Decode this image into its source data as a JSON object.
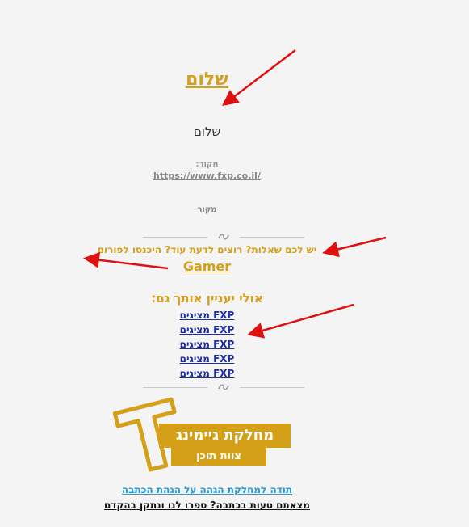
{
  "post": {
    "title": "שלום",
    "greeting": "שלום",
    "source_label": "מקור:",
    "source_url": "https://www.fxp.co.il/",
    "source_link": "מקור"
  },
  "forum": {
    "question": "יש לכם שאלות? רוצים לדעת עוד? היכנסו לפורום",
    "forum_link": "Gamer"
  },
  "related": {
    "heading": "אולי יעניין אותך גם:",
    "items": [
      "FXP מציגים",
      "FXP מציגים",
      "FXP מציגים",
      "FXP מציגים",
      "FXP מציגים"
    ]
  },
  "banner": {
    "logo_letter": "T",
    "department": "מחלקת גיימינג",
    "team": "צוות תוכן"
  },
  "footer": {
    "thanks": "תודה למחלקת הגהה על הגהת הכתבה",
    "errors": "מצאתם טעות בכתבה? ספרו לנו ונתקן בהקדם"
  },
  "colors": {
    "accent": "#d4a017",
    "link": "#1c2ea8",
    "thanks": "#2a9bd8",
    "arrow": "#e01010"
  }
}
